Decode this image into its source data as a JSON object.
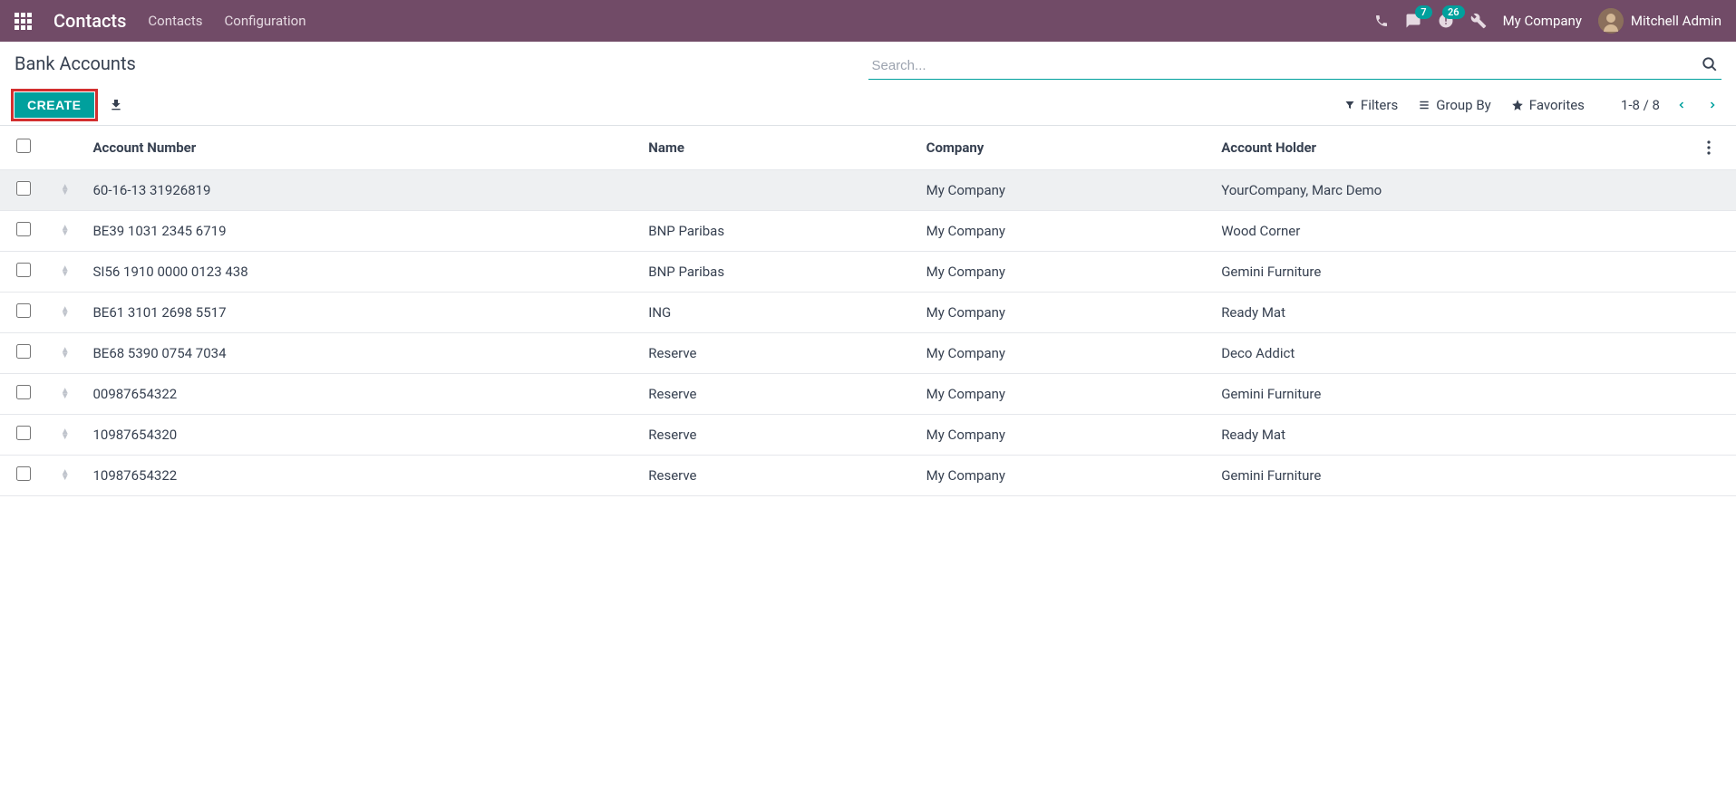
{
  "navbar": {
    "brand": "Contacts",
    "links": [
      "Contacts",
      "Configuration"
    ],
    "messaging_badge": "7",
    "activities_badge": "26",
    "company": "My Company",
    "username": "Mitchell Admin"
  },
  "page": {
    "title": "Bank Accounts",
    "search_placeholder": "Search...",
    "create_label": "CREATE",
    "filters_label": "Filters",
    "groupby_label": "Group By",
    "favorites_label": "Favorites",
    "pager": "1-8 / 8"
  },
  "table": {
    "headers": {
      "account_number": "Account Number",
      "name": "Name",
      "company": "Company",
      "account_holder": "Account Holder"
    },
    "rows": [
      {
        "account_number": "60-16-13 31926819",
        "name": "",
        "company": "My Company",
        "account_holder": "YourCompany, Marc Demo",
        "selected": true
      },
      {
        "account_number": "BE39 1031 2345 6719",
        "name": "BNP Paribas",
        "company": "My Company",
        "account_holder": "Wood Corner",
        "selected": false
      },
      {
        "account_number": "SI56 1910 0000 0123 438",
        "name": "BNP Paribas",
        "company": "My Company",
        "account_holder": "Gemini Furniture",
        "selected": false
      },
      {
        "account_number": "BE61 3101 2698 5517",
        "name": "ING",
        "company": "My Company",
        "account_holder": "Ready Mat",
        "selected": false
      },
      {
        "account_number": "BE68 5390 0754 7034",
        "name": "Reserve",
        "company": "My Company",
        "account_holder": "Deco Addict",
        "selected": false
      },
      {
        "account_number": "00987654322",
        "name": "Reserve",
        "company": "My Company",
        "account_holder": "Gemini Furniture",
        "selected": false
      },
      {
        "account_number": "10987654320",
        "name": "Reserve",
        "company": "My Company",
        "account_holder": "Ready Mat",
        "selected": false
      },
      {
        "account_number": "10987654322",
        "name": "Reserve",
        "company": "My Company",
        "account_holder": "Gemini Furniture",
        "selected": false
      }
    ]
  }
}
